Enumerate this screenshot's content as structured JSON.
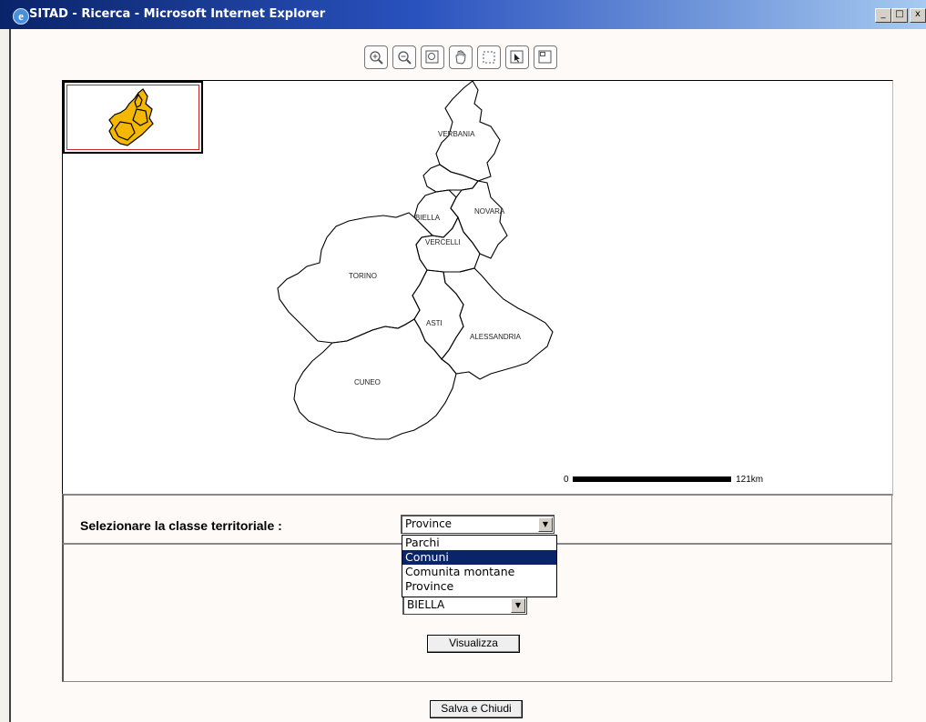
{
  "window": {
    "title": "SITAD - Ricerca - Microsoft Internet Explorer",
    "minimize_glyph": "_",
    "maximize_glyph": "□",
    "close_glyph": "x"
  },
  "toolbar": {
    "tools": [
      "zoom-in-icon",
      "zoom-out-icon",
      "full-extent-icon",
      "pan-hand-icon",
      "select-rectangle-icon",
      "identify-icon",
      "overview-icon"
    ]
  },
  "map": {
    "labels": {
      "verbania": "VERBANIA",
      "biella": "BIELLA",
      "novara": "NOVARA",
      "vercelli": "VERCELLI",
      "torino": "TORINO",
      "asti": "ASTI",
      "alessandria": "ALESSANDRIA",
      "cuneo": "CUNEO"
    },
    "scale": {
      "start": "0",
      "end": "121km"
    },
    "overview_fill": "#f5b800"
  },
  "class_selector": {
    "label": "Selezionare la classe territoriale :",
    "selected": "Province",
    "options": [
      "Parchi",
      "Comuni",
      "Comunita montane",
      "Province"
    ],
    "highlighted": "Comuni"
  },
  "sub_selector": {
    "selected": "BIELLA"
  },
  "buttons": {
    "visualizza": "Visualizza",
    "salva_chiudi": "Salva e Chiudi"
  }
}
